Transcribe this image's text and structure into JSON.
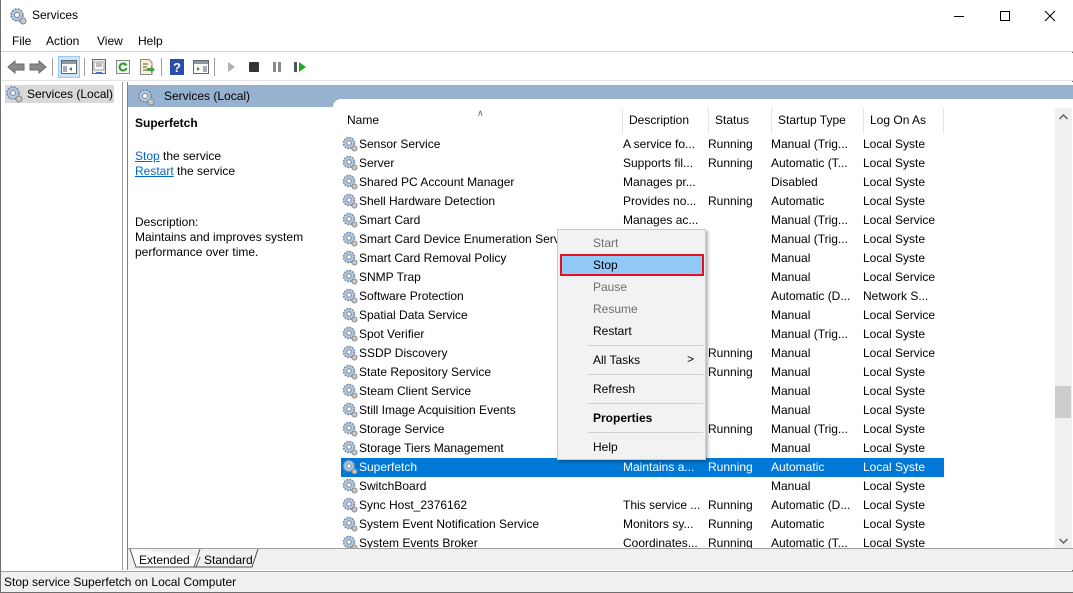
{
  "window": {
    "title": "Services",
    "controls": {
      "minimize": "minimize",
      "maximize": "maximize",
      "close": "close"
    }
  },
  "menubar": {
    "items": [
      "File",
      "Action",
      "View",
      "Help"
    ]
  },
  "toolbar": {
    "buttons": [
      "back-icon",
      "forward-icon",
      "show-hide-console-tree-icon",
      "properties-icon",
      "refresh-icon",
      "export-list-icon",
      "help-icon",
      "show-action-pane-icon",
      "start-service-icon",
      "stop-service-icon",
      "pause-service-icon",
      "restart-service-icon"
    ]
  },
  "tree": {
    "root": "Services (Local)"
  },
  "pane": {
    "header": "Services (Local)",
    "selected_service": "Superfetch",
    "actions": [
      {
        "link": "Stop",
        "rest": " the service"
      },
      {
        "link": "Restart",
        "rest": " the service"
      }
    ],
    "description_label": "Description:",
    "description": "Maintains and improves system performance over time."
  },
  "list": {
    "columns": [
      "Name",
      "Description",
      "Status",
      "Startup Type",
      "Log On As"
    ],
    "sorted_column": "Name",
    "rows": [
      {
        "name": "Sensor Service",
        "description": "A service fo...",
        "status": "Running",
        "startup": "Manual (Trig...",
        "logon": "Local Syste"
      },
      {
        "name": "Server",
        "description": "Supports fil...",
        "status": "Running",
        "startup": "Automatic (T...",
        "logon": "Local Syste"
      },
      {
        "name": "Shared PC Account Manager",
        "description": "Manages pr...",
        "status": "",
        "startup": "Disabled",
        "logon": "Local Syste"
      },
      {
        "name": "Shell Hardware Detection",
        "description": "Provides no...",
        "status": "Running",
        "startup": "Automatic",
        "logon": "Local Syste"
      },
      {
        "name": "Smart Card",
        "description": "Manages ac...",
        "status": "",
        "startup": "Manual (Trig...",
        "logon": "Local Service"
      },
      {
        "name": "Smart Card Device Enumeration Service",
        "description": "",
        "status": "",
        "startup": "Manual (Trig...",
        "logon": "Local Syste"
      },
      {
        "name": "Smart Card Removal Policy",
        "description": "",
        "status": "",
        "startup": "Manual",
        "logon": "Local Syste"
      },
      {
        "name": "SNMP Trap",
        "description": "",
        "status": "",
        "startup": "Manual",
        "logon": "Local Service"
      },
      {
        "name": "Software Protection",
        "description": "",
        "status": "",
        "startup": "Automatic (D...",
        "logon": "Network S..."
      },
      {
        "name": "Spatial Data Service",
        "description": "",
        "status": "",
        "startup": "Manual",
        "logon": "Local Service"
      },
      {
        "name": "Spot Verifier",
        "description": "",
        "status": "",
        "startup": "Manual (Trig...",
        "logon": "Local Syste"
      },
      {
        "name": "SSDP Discovery",
        "description": "",
        "status": "Running",
        "startup": "Manual",
        "logon": "Local Service"
      },
      {
        "name": "State Repository Service",
        "description": "",
        "status": "Running",
        "startup": "Manual",
        "logon": "Local Syste"
      },
      {
        "name": "Steam Client Service",
        "description": "",
        "status": "",
        "startup": "Manual",
        "logon": "Local Syste"
      },
      {
        "name": "Still Image Acquisition Events",
        "description": "",
        "status": "",
        "startup": "Manual",
        "logon": "Local Syste"
      },
      {
        "name": "Storage Service",
        "description": "",
        "status": "Running",
        "startup": "Manual (Trig...",
        "logon": "Local Syste"
      },
      {
        "name": "Storage Tiers Management",
        "description": "",
        "status": "",
        "startup": "Manual",
        "logon": "Local Syste"
      },
      {
        "name": "Superfetch",
        "description": "Maintains a...",
        "status": "Running",
        "startup": "Automatic",
        "logon": "Local Syste",
        "selected": true
      },
      {
        "name": "SwitchBoard",
        "description": "",
        "status": "",
        "startup": "Manual",
        "logon": "Local Syste"
      },
      {
        "name": "Sync Host_2376162",
        "description": "This service ...",
        "status": "Running",
        "startup": "Automatic (D...",
        "logon": "Local Syste"
      },
      {
        "name": "System Event Notification Service",
        "description": "Monitors sy...",
        "status": "Running",
        "startup": "Automatic",
        "logon": "Local Syste"
      },
      {
        "name": "System Events Broker",
        "description": "Coordinates...",
        "status": "Running",
        "startup": "Automatic (T...",
        "logon": "Local Syste"
      }
    ]
  },
  "context_menu": {
    "items": [
      {
        "label": "Start",
        "disabled": true
      },
      {
        "label": "Stop",
        "highlighted": true
      },
      {
        "label": "Pause",
        "disabled": true
      },
      {
        "label": "Resume",
        "disabled": true
      },
      {
        "label": "Restart"
      },
      {
        "separator": true
      },
      {
        "label": "All Tasks",
        "submenu": true
      },
      {
        "separator": true
      },
      {
        "label": "Refresh"
      },
      {
        "separator": true
      },
      {
        "label": "Properties",
        "bold": true
      },
      {
        "separator": true
      },
      {
        "label": "Help"
      }
    ],
    "submenu_glyph": ">"
  },
  "tabs": [
    "Extended",
    "Standard"
  ],
  "active_tab": "Extended",
  "status_text": "Stop service Superfetch on Local Computer",
  "colors": {
    "selection": "#0078d7",
    "header_band": "#97b2cf",
    "menu_highlight": "#91c9f7",
    "highlight_border": "#e81123",
    "link": "#0066cc"
  }
}
